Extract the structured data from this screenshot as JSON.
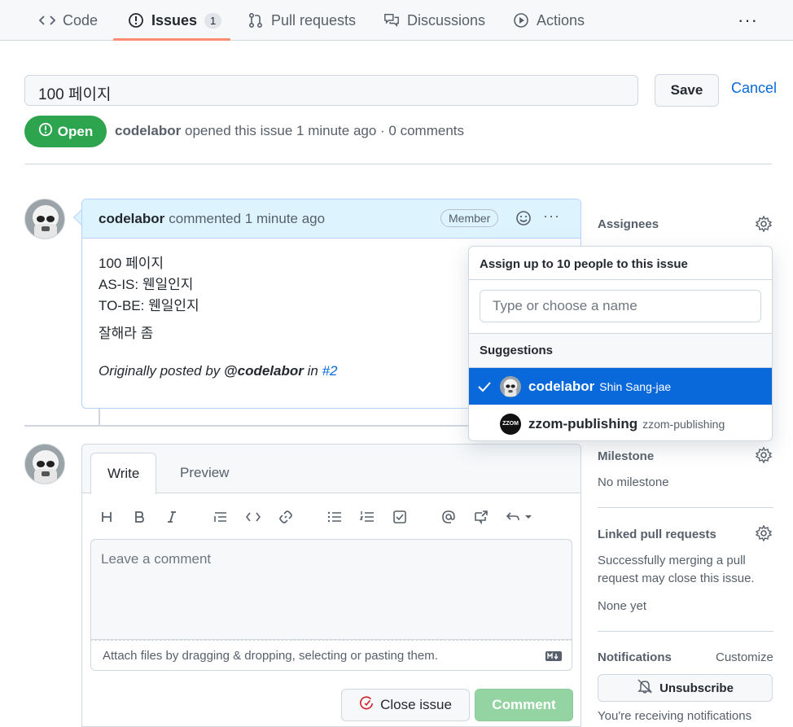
{
  "nav": {
    "items": [
      {
        "label": "Code",
        "icon": "code-icon"
      },
      {
        "label": "Issues",
        "icon": "issue-opened-icon",
        "count": "1"
      },
      {
        "label": "Pull requests",
        "icon": "git-pull-request-icon"
      },
      {
        "label": "Discussions",
        "icon": "comment-discussion-icon"
      },
      {
        "label": "Actions",
        "icon": "play-icon"
      }
    ],
    "more": "···"
  },
  "issue": {
    "title_value": "100 페이지",
    "save_label": "Save",
    "cancel_label": "Cancel",
    "state": "Open",
    "author": "codelabor",
    "meta": "opened this issue 1 minute ago · 0 comments"
  },
  "comment": {
    "author": "codelabor",
    "action": "commented 1 minute ago",
    "badge": "Member",
    "lines": [
      "100 페이지",
      "AS-IS: 웬일인지",
      "TO-BE: 웬일인지"
    ],
    "paragraph": "잘해라 좀",
    "orig_prefix": "Originally posted by",
    "orig_user": "@codelabor",
    "orig_in": "in",
    "orig_ref": "#2"
  },
  "composer": {
    "tab_write": "Write",
    "tab_preview": "Preview",
    "placeholder": "Leave a comment",
    "attach_text": "Attach files by dragging & dropping, selecting or pasting them.",
    "close_label": "Close issue",
    "comment_label": "Comment"
  },
  "sidebar": {
    "assignees_label": "Assignees",
    "milestone_label": "Milestone",
    "milestone_value": "No milestone",
    "linked_label": "Linked pull requests",
    "linked_desc": "Successfully merging a pull request may close this issue.",
    "linked_value": "None yet",
    "notifications_label": "Notifications",
    "customize_label": "Customize",
    "unsubscribe_label": "Unsubscribe",
    "receiving_text": "You're receiving notifications"
  },
  "assign_dropdown": {
    "header": "Assign up to 10 people to this issue",
    "placeholder": "Type or choose a name",
    "suggestions_label": "Suggestions",
    "people": [
      {
        "login": "codelabor",
        "name": "Shin Sang-jae",
        "selected": true
      },
      {
        "login": "zzom-publishing",
        "name": "zzom-publishing",
        "selected": false,
        "avatar_text": "ZZOM"
      }
    ]
  },
  "colors": {
    "accent": "#0969da",
    "open_green": "#2da44e",
    "underline": "#fd8c73"
  }
}
